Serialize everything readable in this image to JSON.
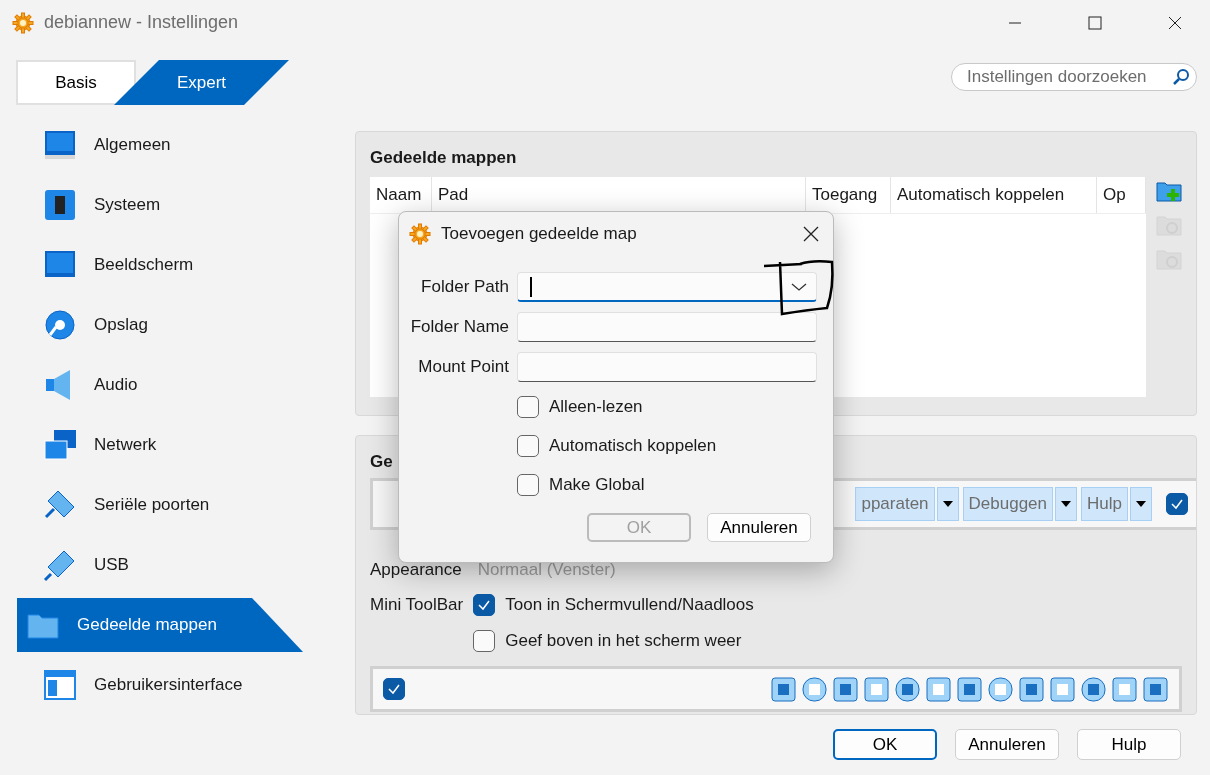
{
  "window": {
    "title": "debiannew - Instellingen"
  },
  "mode_tabs": [
    {
      "label": "Basis",
      "selected": false
    },
    {
      "label": "Expert",
      "selected": true
    }
  ],
  "search": {
    "placeholder": "Instellingen doorzoeken"
  },
  "sidebar": {
    "items": [
      {
        "label": "Algemeen",
        "selected": false
      },
      {
        "label": "Systeem",
        "selected": false
      },
      {
        "label": "Beeldscherm",
        "selected": false
      },
      {
        "label": "Opslag",
        "selected": false
      },
      {
        "label": "Audio",
        "selected": false
      },
      {
        "label": "Netwerk",
        "selected": false
      },
      {
        "label": "Seriële poorten",
        "selected": false
      },
      {
        "label": "USB",
        "selected": false
      },
      {
        "label": "Gedeelde mappen",
        "selected": true
      },
      {
        "label": "Gebruikersinterface",
        "selected": false
      }
    ]
  },
  "shared_folders": {
    "title": "Gedeelde mappen",
    "table": {
      "columns": [
        "Naam",
        "Pad",
        "Toegang",
        "Automatisch koppelen",
        "Op"
      ]
    },
    "actions": [
      {
        "disabled": false
      },
      {
        "disabled": true
      },
      {
        "disabled": true
      }
    ]
  },
  "user_interface": {
    "title": "Ge",
    "menu_bar": {
      "items": [
        "pparaten",
        "Debuggen",
        "Hulp"
      ],
      "checked": true
    },
    "appearance": {
      "label": "Appearance",
      "value": "Normaal (Venster)"
    },
    "mini_toolbar": {
      "label": "Mini ToolBar",
      "options": [
        {
          "label": "Toon in Schermvullend/Naadloos",
          "checked": true
        },
        {
          "label": "Geef boven in het scherm weer",
          "checked": false
        }
      ]
    },
    "status_bar": {
      "checked": true
    }
  },
  "buttons": [
    {
      "label": "OK",
      "default": true
    },
    {
      "label": "Annuleren",
      "default": false
    },
    {
      "label": "Hulp",
      "default": false
    }
  ],
  "dialog": {
    "title": "Toevoegen gedeelde map",
    "fields": [
      {
        "label": "Folder Path",
        "kind": "combo",
        "focused": true
      },
      {
        "label": "Folder Name",
        "kind": "text",
        "focused": false
      },
      {
        "label": "Mount Point",
        "kind": "text",
        "focused": false
      }
    ],
    "options": [
      {
        "label": "Alleen-lezen",
        "checked": false
      },
      {
        "label": "Automatisch koppelen",
        "checked": false
      },
      {
        "label": "Make Global",
        "checked": false
      }
    ],
    "buttons": [
      {
        "label": "OK",
        "disabled": true
      },
      {
        "label": "Annuleren",
        "disabled": false
      }
    ]
  }
}
